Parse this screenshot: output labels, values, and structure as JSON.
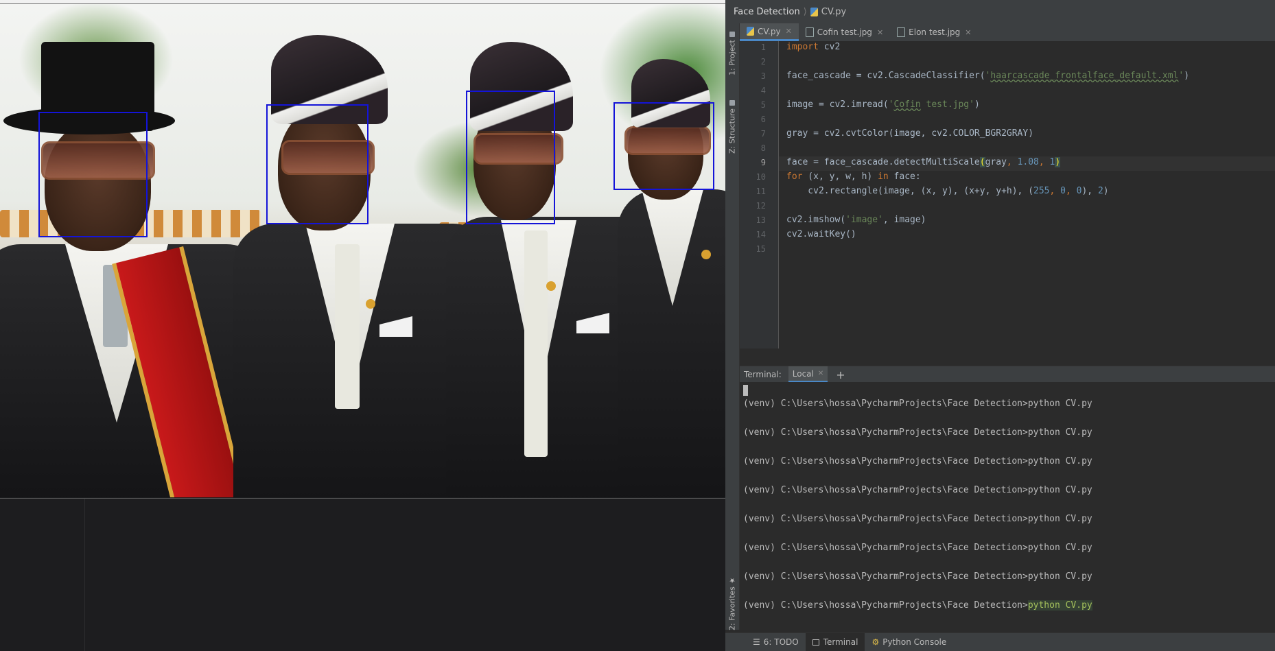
{
  "image_viewer": {
    "face_boxes_count": 4
  },
  "ide": {
    "breadcrumb": {
      "project": "Face Detection",
      "file": "CV.py"
    },
    "side_toolbar": {
      "project_label": "1: Project",
      "structure_label": "Z: Structure",
      "favorites_label": "2: Favorites"
    },
    "tabs": [
      {
        "label": "CV.py",
        "active": true
      },
      {
        "label": "Cofin test.jpg",
        "active": false
      },
      {
        "label": "Elon test.jpg",
        "active": false
      }
    ],
    "editor": {
      "line_numbers": [
        "1",
        "2",
        "3",
        "4",
        "5",
        "6",
        "7",
        "8",
        "9",
        "10",
        "11",
        "12",
        "13",
        "14",
        "15"
      ],
      "current_line": 9,
      "lines": {
        "l1_kw": "import",
        "l1_rest": " cv2",
        "l3_a": "face_cascade = cv2.CascadeClassifier(",
        "l3_str_q1": "'",
        "l3_str": "haarcascade_frontalface_default.xml",
        "l3_str_q2": "'",
        "l3_b": ")",
        "l5_a": "image = cv2.imread(",
        "l5_q1": "'",
        "l5_str_ul": "Cofin",
        "l5_str_rest": " test.jpg'",
        "l5_b": ")",
        "l7": "gray = cv2.cvtColor(image, cv2.COLOR_BGR2GRAY)",
        "l9_a": "face = face_cascade.detectMultiScale",
        "l9_paren_open": "(",
        "l9_gray": "gray",
        "l9_c1": ", ",
        "l9_n1": "1.08",
        "l9_c2": ", ",
        "l9_n2": "1",
        "l9_paren_close": ")",
        "l10_kw": "for",
        "l10_a": " (x, y, w, h) ",
        "l10_in": "in",
        "l10_b": " face:",
        "l11_a": "    cv2.rectangle(image, (x, y), (x+y, y+h), (",
        "l11_n1": "255",
        "l11_c1": ", ",
        "l11_n2": "0",
        "l11_c2": ", ",
        "l11_n3": "0",
        "l11_b": "), ",
        "l11_n4": "2",
        "l11_c": ")",
        "l13_a": "cv2.imshow(",
        "l13_str": "'image'",
        "l13_b": ", image)",
        "l14": "cv2.waitKey()"
      }
    },
    "terminal": {
      "label": "Terminal:",
      "tab": "Local",
      "add": "+",
      "prompt": "(venv) C:\\Users\\hossa\\PycharmProjects\\Face Detection>",
      "command": "python CV.py",
      "lines": [
        "(venv) C:\\Users\\hossa\\PycharmProjects\\Face Detection>python CV.py",
        "(venv) C:\\Users\\hossa\\PycharmProjects\\Face Detection>python CV.py",
        "(venv) C:\\Users\\hossa\\PycharmProjects\\Face Detection>python CV.py",
        "(venv) C:\\Users\\hossa\\PycharmProjects\\Face Detection>python CV.py",
        "(venv) C:\\Users\\hossa\\PycharmProjects\\Face Detection>python CV.py",
        "(venv) C:\\Users\\hossa\\PycharmProjects\\Face Detection>python CV.py",
        "(venv) C:\\Users\\hossa\\PycharmProjects\\Face Detection>python CV.py"
      ]
    },
    "bottom_tabs": {
      "todo": "6: TODO",
      "terminal": "Terminal",
      "python_console": "Python Console"
    }
  },
  "colors": {
    "face_box": "#1414d8",
    "keyword": "#cc7832",
    "string": "#6a8759",
    "number": "#6897bb",
    "accent": "#4a88c7"
  }
}
